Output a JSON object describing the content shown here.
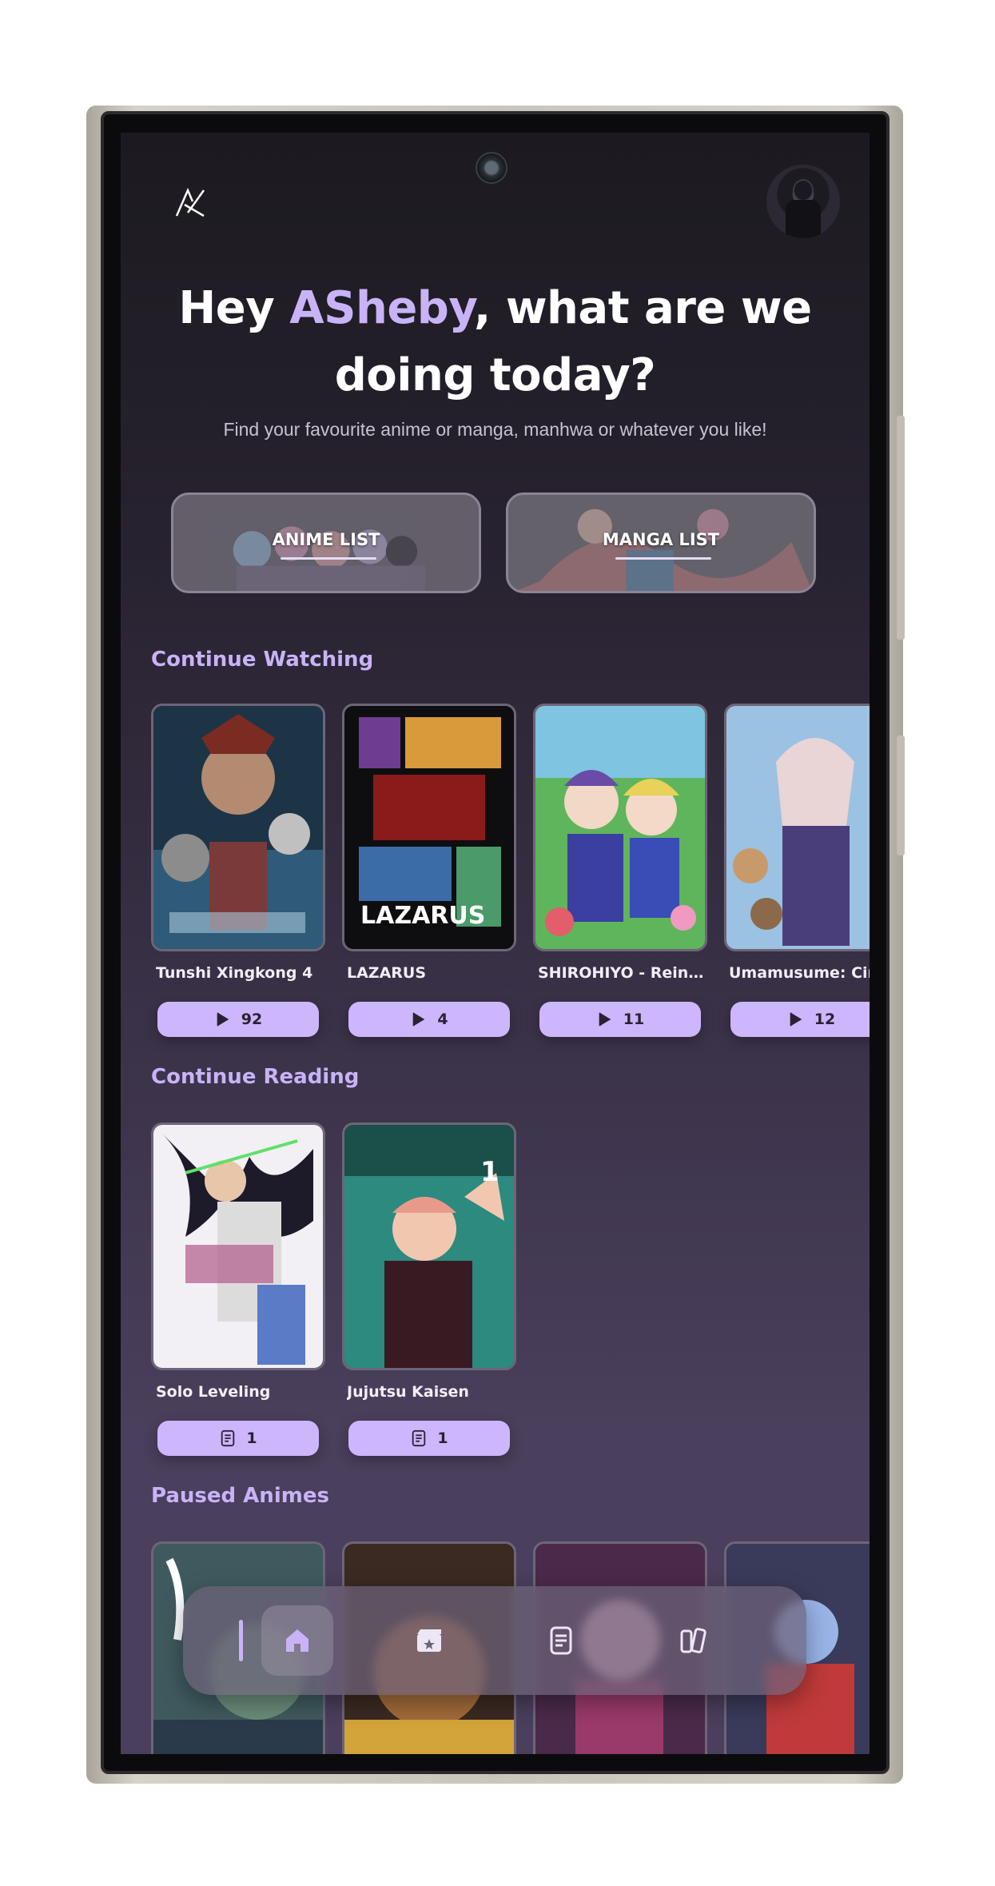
{
  "header": {
    "logo_alt": "AX",
    "greeting_prefix": "Hey ",
    "user_name": "ASheby",
    "greeting_suffix": ", what are we doing today?",
    "subtitle": "Find your favourite anime or manga, manhwa or whatever you like!"
  },
  "buttons": {
    "anime_list": "ANIME LIST",
    "manga_list": "MANGA LIST"
  },
  "sections": {
    "continue_watching": {
      "title": "Continue Watching",
      "items": [
        {
          "title": "Tunshi Xingkong 4",
          "count": "92",
          "icon": "play-icon"
        },
        {
          "title": "LAZARUS",
          "count": "4",
          "icon": "play-icon"
        },
        {
          "title": "SHIROHIYO - Reincarnated as a Neglected Noble",
          "count": "11",
          "icon": "play-icon"
        },
        {
          "title": "Umamusume: Cinderella Gray",
          "count": "12",
          "icon": "play-icon"
        }
      ]
    },
    "continue_reading": {
      "title": "Continue Reading",
      "items": [
        {
          "title": "Solo Leveling",
          "count": "1",
          "icon": "book-icon"
        },
        {
          "title": "Jujutsu Kaisen",
          "count": "1",
          "icon": "book-icon"
        }
      ]
    },
    "paused_animes": {
      "title": "Paused Animes"
    }
  },
  "nav": {
    "items": [
      {
        "name": "home",
        "icon": "home-icon",
        "active": true
      },
      {
        "name": "anime",
        "icon": "clapperboard-icon",
        "active": false
      },
      {
        "name": "manga",
        "icon": "book-icon",
        "active": false
      },
      {
        "name": "library",
        "icon": "library-icon",
        "active": false
      }
    ]
  },
  "colors": {
    "accent": "#c9b3f7",
    "pill": "#cdb6fb",
    "screen_bg_top": "#1c1a20",
    "screen_bg_bottom": "#4a3f5c"
  }
}
